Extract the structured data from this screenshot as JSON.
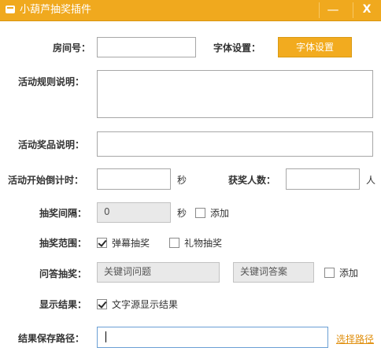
{
  "window": {
    "title": "小葫芦抽奖插件",
    "minimize_glyph": "—",
    "close_glyph": "X",
    "icon": "gourd-icon",
    "accent_color": "#f0a91e"
  },
  "form": {
    "room": {
      "label": "房间号：",
      "value": ""
    },
    "font": {
      "label": "字体设置：",
      "button": "字体设置"
    },
    "rules": {
      "label": "活动规则说明：",
      "value": ""
    },
    "prizes": {
      "label": "活动奖品说明：",
      "value": ""
    },
    "countdown": {
      "label": "活动开始倒计时：",
      "value": "",
      "unit": "秒"
    },
    "winners": {
      "label": "获奖人数：",
      "value": "",
      "unit": "人"
    },
    "interval": {
      "label": "抽奖间隔：",
      "value": "0",
      "unit": "秒",
      "checkbox_label": "添加",
      "checked": false
    },
    "scope": {
      "label": "抽奖范围：",
      "options": [
        {
          "label": "弹幕抽奖",
          "checked": true
        },
        {
          "label": "礼物抽奖",
          "checked": false
        }
      ]
    },
    "qa": {
      "label": "问答抽奖：",
      "question_value": "关键词问题",
      "answer_value": "关键词答案",
      "checkbox_label": "添加",
      "checked": false
    },
    "display": {
      "label": "显示结果：",
      "checkbox_label": "文字源显示结果",
      "checked": true
    },
    "save_path": {
      "label": "结果保存路径：",
      "value": "",
      "link": "选择路径"
    }
  }
}
